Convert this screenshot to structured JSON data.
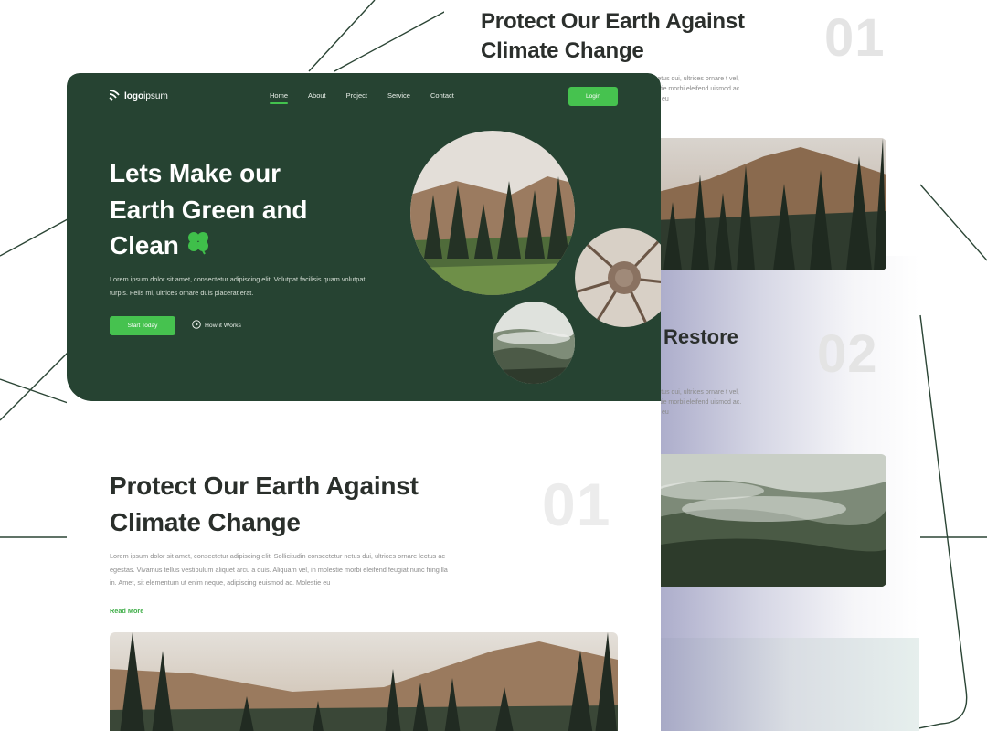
{
  "colors": {
    "hero_bg": "#264332",
    "accent_green": "#46c24f",
    "heading_dark": "#2a2f2b",
    "number_gray": "#ececec",
    "line_color": "#2b4535"
  },
  "brand": {
    "logo_prefix": "logo",
    "logo_suffix": "ipsum",
    "icon": "logo-icon"
  },
  "nav": {
    "items": [
      {
        "label": "Home",
        "active": true
      },
      {
        "label": "About",
        "active": false
      },
      {
        "label": "Project",
        "active": false
      },
      {
        "label": "Service",
        "active": false
      },
      {
        "label": "Contact",
        "active": false
      }
    ],
    "login_label": "Login"
  },
  "hero": {
    "title_line1": "Lets Make our",
    "title_line2": "Earth Green and",
    "title_line3": "Clean",
    "clover_icon": "shamrock-icon",
    "description": "Lorem ipsum dolor sit amet, consectetur adipiscing elit. Volutpat facilisis quam volutpat turpis. Felis mi, ultrices ornare duis placerat erat.",
    "primary_button": "Start Today",
    "secondary_button": "How it Works",
    "secondary_icon": "play-circle-icon"
  },
  "section1": {
    "title": "Protect Our Earth Against Climate Change",
    "number": "01",
    "paragraph": "Lorem ipsum dolor sit amet, consectetur adipiscing elit. Sollicitudin consectetur netus dui, ultrices ornare lectus ac egestas. Vivamus tellus vestibulum aliquet arcu a duis. Aliquam vel, in molestie morbi eleifend feugiat nunc fringilla in. Amet, sit elementum ut enim neque, adipiscing euismod ac. Molestie eu",
    "read_more": "Read More"
  },
  "back_page": {
    "section1_title": "Protect Our Earth Against Climate Change",
    "section1_number": "01",
    "section1_snippet": "ctetur netus dui, ultrices ornare t vel, in molestie morbi eleifend uismod ac. Molestie eu",
    "section2_title": "Restore",
    "section2_number": "02",
    "section2_snippet": "ctetur netus dui, ultrices ornare t vel, in molestie morbi eleifend uismod ac. Molestie eu"
  }
}
